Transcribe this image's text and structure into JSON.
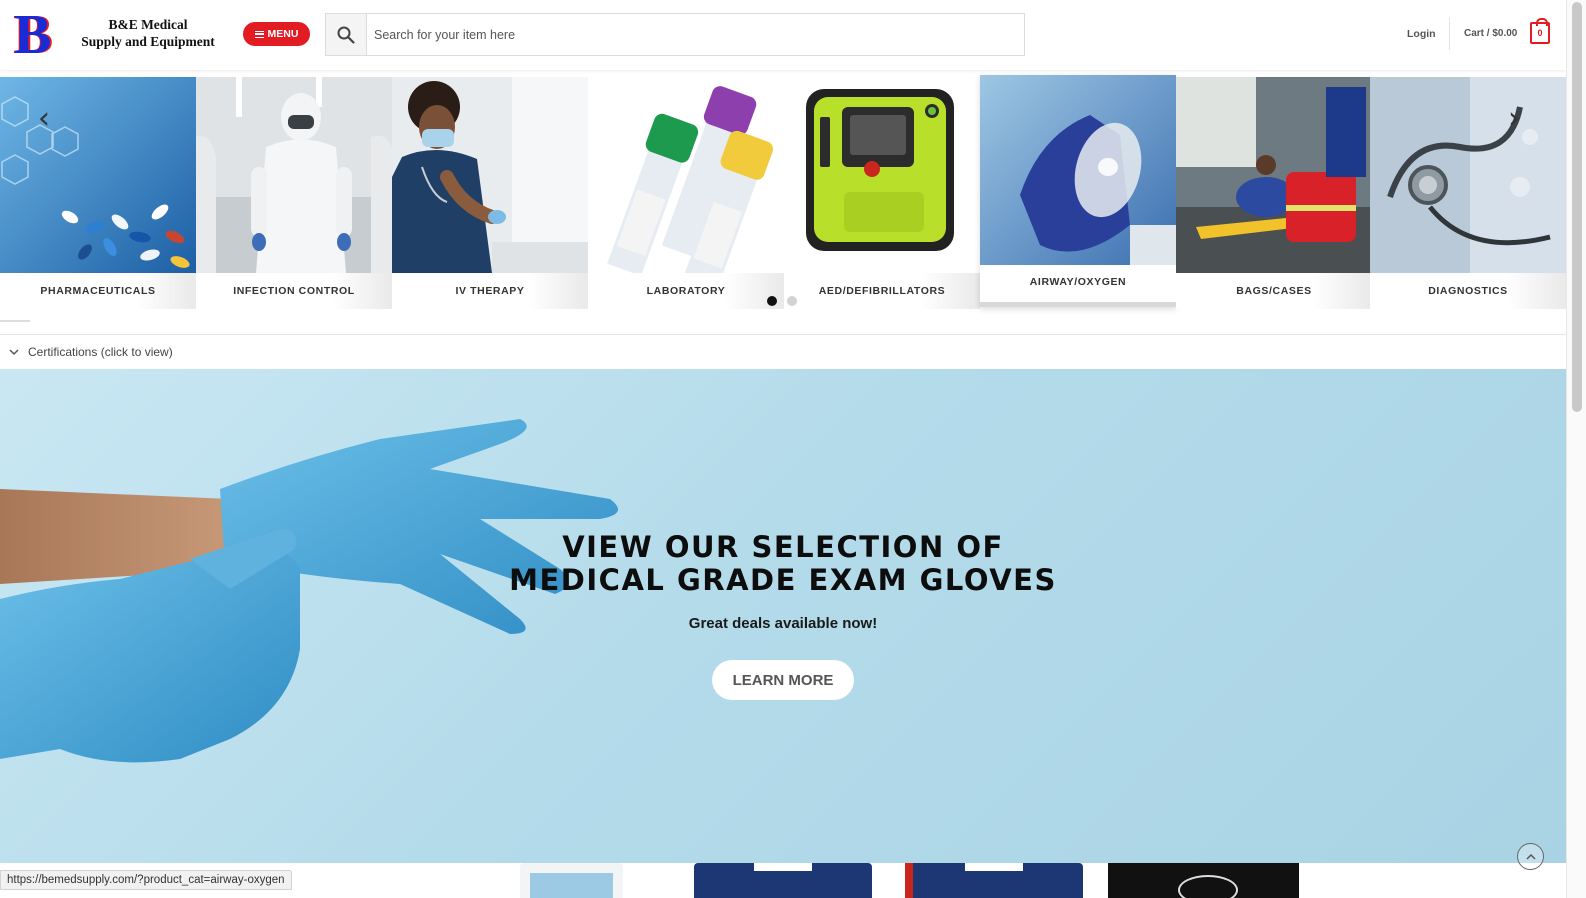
{
  "header": {
    "logo_letter": "B",
    "logo_text": "B&E Medical Supply and Equipment",
    "menu_label": "MENU",
    "search_placeholder": "Search for your item here",
    "login_label": "Login",
    "cart_label": "Cart / $0.00",
    "cart_count": "0",
    "icons": [
      "menu-bars-icon",
      "search-icon",
      "cart-bag-icon"
    ]
  },
  "categories": [
    {
      "label": "PHARMACEUTICALS"
    },
    {
      "label": "INFECTION CONTROL"
    },
    {
      "label": "IV THERAPY"
    },
    {
      "label": "LABORATORY"
    },
    {
      "label": "AED/DEFIBRILLATORS"
    },
    {
      "label": "AIRWAY/OXYGEN"
    },
    {
      "label": "BAGS/CASES"
    },
    {
      "label": "DIAGNOSTICS"
    }
  ],
  "slider": {
    "active_index": 5,
    "dots": 2,
    "active_dot": 0
  },
  "certifications": {
    "label": "Certifications (click to view)"
  },
  "banner": {
    "title_line1": "VIEW OUR SELECTION OF",
    "title_line2": "MEDICAL GRADE EXAM GLOVES",
    "subtitle": "Great deals available now!",
    "cta_label": "LEARN MORE"
  },
  "status_bar": {
    "url": "https://bemedsupply.com/?product_cat=airway-oxygen"
  },
  "colors": {
    "brand_red": "#e31b23",
    "brand_blue": "#1a2bd6",
    "banner_bg": "#b4dbea"
  }
}
